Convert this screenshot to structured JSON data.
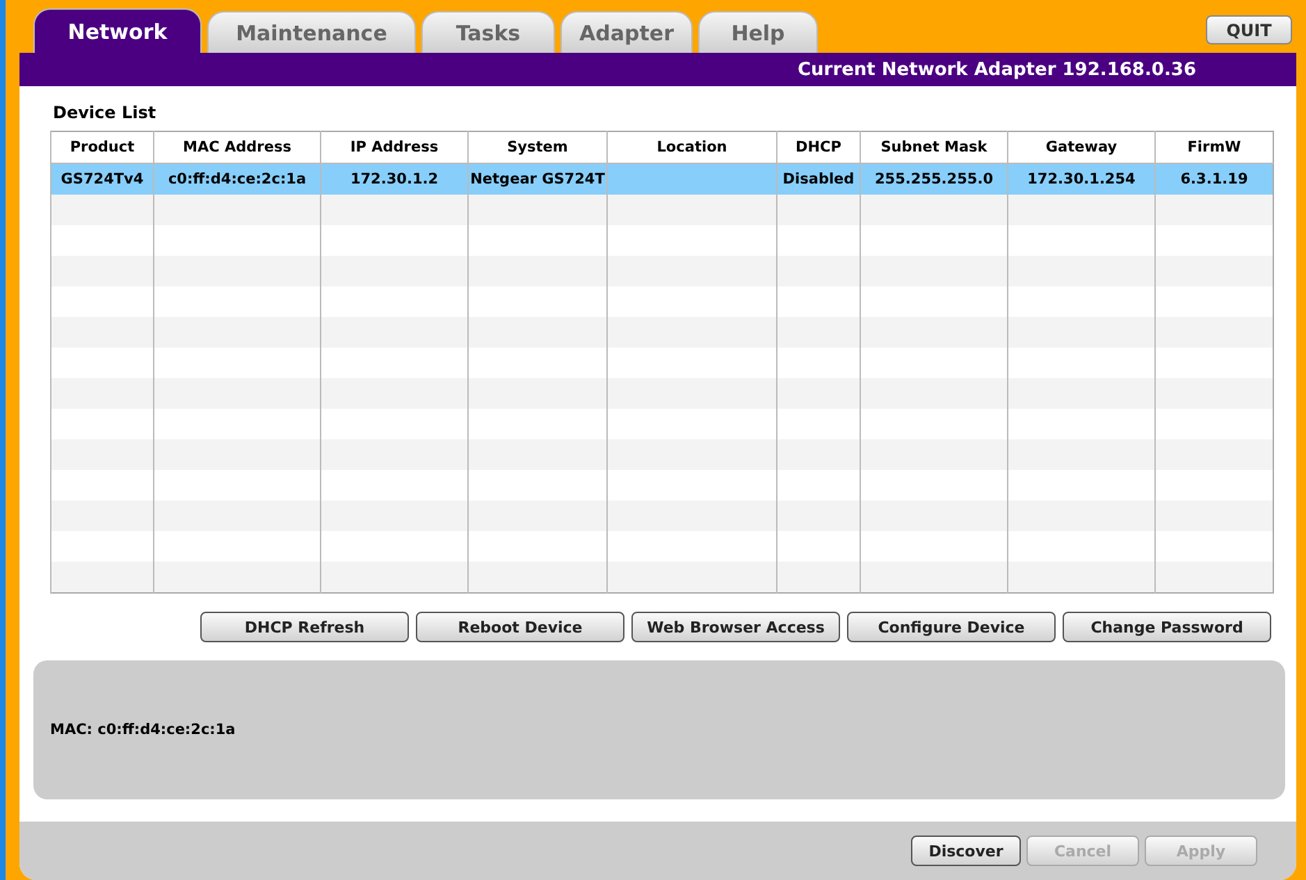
{
  "tabs": [
    {
      "label": "Network",
      "selected": true
    },
    {
      "label": "Maintenance",
      "selected": false
    },
    {
      "label": "Tasks",
      "selected": false
    },
    {
      "label": "Adapter",
      "selected": false
    },
    {
      "label": "Help",
      "selected": false
    }
  ],
  "quit_button": "QUIT",
  "adapter_banner": "Current Network Adapter 192.168.0.36",
  "device_list": {
    "title": "Device List",
    "columns": [
      "Product",
      "MAC Address",
      "IP Address",
      "System",
      "Location",
      "DHCP",
      "Subnet Mask",
      "Gateway",
      "FirmW"
    ],
    "rows": [
      {
        "selected": true,
        "cells": [
          "GS724Tv4",
          "c0:ff:d4:ce:2c:1a",
          "172.30.1.2",
          "Netgear GS724T",
          "",
          "Disabled",
          "255.255.255.0",
          "172.30.1.254",
          "6.3.1.19"
        ]
      }
    ]
  },
  "actions": [
    {
      "label": "DHCP Refresh",
      "disabled": false
    },
    {
      "label": "Reboot Device",
      "disabled": false
    },
    {
      "label": "Web Browser Access",
      "disabled": false
    },
    {
      "label": "Configure Device",
      "disabled": false
    },
    {
      "label": "Change Password",
      "disabled": false
    }
  ],
  "info_panel": {
    "text": "MAC: c0:ff:d4:ce:2c:1a"
  },
  "footer_buttons": [
    {
      "label": "Discover",
      "disabled": false
    },
    {
      "label": "Cancel",
      "disabled": true
    },
    {
      "label": "Apply",
      "disabled": true
    }
  ]
}
